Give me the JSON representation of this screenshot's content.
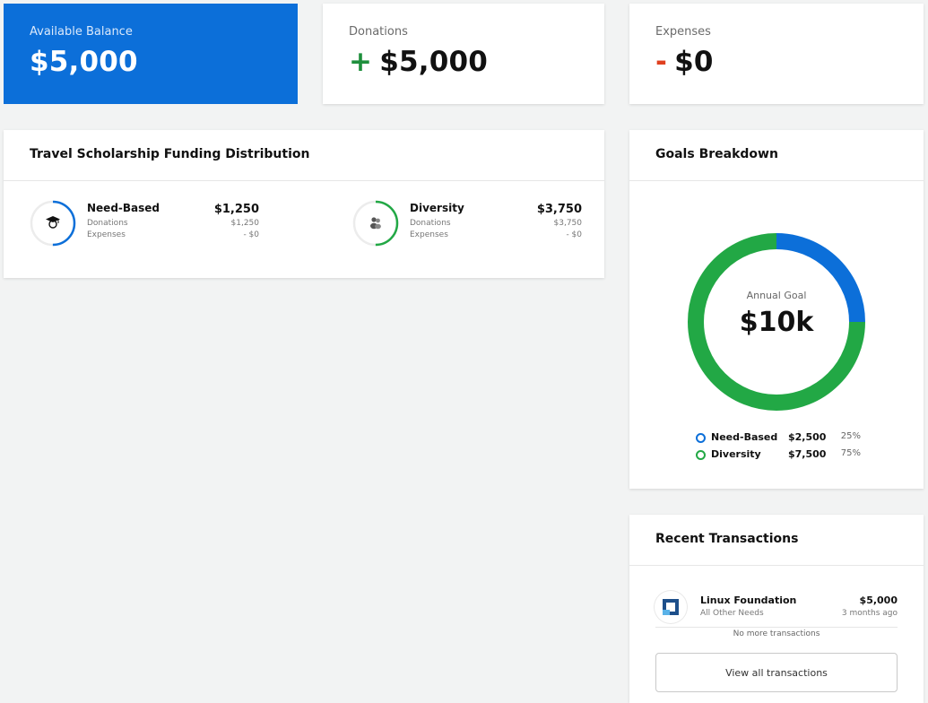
{
  "stats": {
    "balance": {
      "label": "Available Balance",
      "value": "$5,000"
    },
    "donations": {
      "label": "Donations",
      "sign": "+",
      "value": "$5,000"
    },
    "expenses": {
      "label": "Expenses",
      "sign": "-",
      "value": "$0"
    }
  },
  "distribution": {
    "title": "Travel Scholarship Funding Distribution",
    "funds": [
      {
        "name": "Need-Based",
        "icon": "graduate-icon",
        "total": "$1,250",
        "donations_label": "Donations",
        "donations": "$1,250",
        "expenses_label": "Expenses",
        "expenses": "- $0",
        "color": "#0c6fd9",
        "progress": 0.5
      },
      {
        "name": "Diversity",
        "icon": "people-icon",
        "total": "$3,750",
        "donations_label": "Donations",
        "donations": "$3,750",
        "expenses_label": "Expenses",
        "expenses": "- $0",
        "color": "#22a845",
        "progress": 0.5
      }
    ]
  },
  "goals": {
    "title": "Goals Breakdown",
    "center_label": "Annual Goal",
    "center_value": "$10k",
    "segments": [
      {
        "name": "Need-Based",
        "amount": "$2,500",
        "percent": "25%",
        "value": 25,
        "color": "#0c6fd9"
      },
      {
        "name": "Diversity",
        "amount": "$7,500",
        "percent": "75%",
        "value": 75,
        "color": "#22a845"
      }
    ]
  },
  "transactions": {
    "title": "Recent Transactions",
    "items": [
      {
        "name": "Linux Foundation",
        "category": "All Other Needs",
        "amount": "$5,000",
        "time": "3 months ago",
        "logo": "linux-foundation-logo"
      }
    ],
    "empty_note": "No more transactions",
    "view_all_label": "View all transactions"
  },
  "colors": {
    "accent": "#0c6fd9",
    "positive": "#22a845",
    "negative": "#e0401f",
    "background": "#f2f3f3"
  }
}
